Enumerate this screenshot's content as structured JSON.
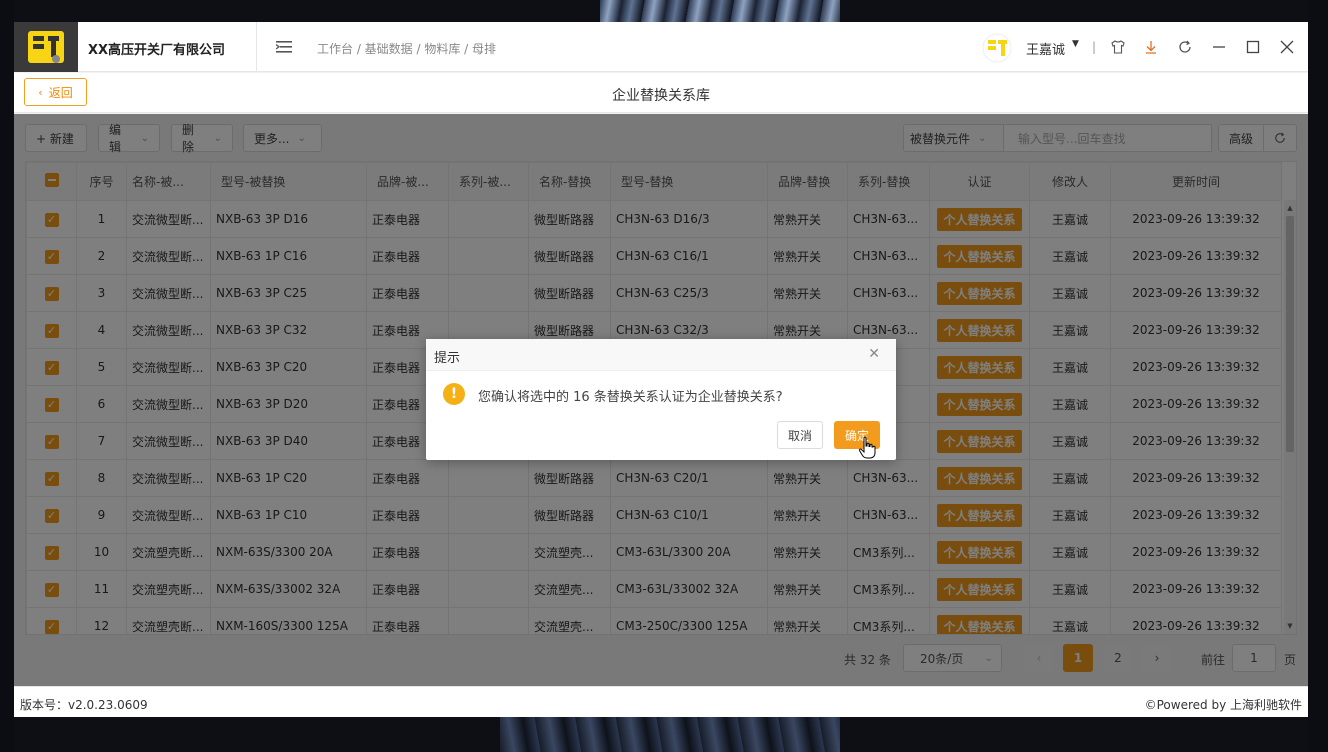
{
  "app": {
    "company": "XX高压开关厂有限公司",
    "breadcrumb": "工作台 / 基础数据 / 物料库 / 母排",
    "user_name": "王嘉诚",
    "separator": "|"
  },
  "subheader": {
    "back_label": "返回",
    "title": "企业替换关系库"
  },
  "toolbar": {
    "new_label": "+ 新建",
    "edit_label": "编辑",
    "delete_label": "删除",
    "more_label": "更多...",
    "search_scope": "被替换元件",
    "search_placeholder": "输入型号...回车查找",
    "advanced_label": "高级"
  },
  "table": {
    "columns": [
      "序号",
      "名称-被...",
      "型号-被替换",
      "品牌-被...",
      "系列-被...",
      "名称-替换",
      "型号-替换",
      "品牌-替换",
      "系列-替换",
      "认证",
      "修改人",
      "更新时间"
    ],
    "rows": [
      {
        "no": "1",
        "name_old": "交流微型断...",
        "model_old": "NXB-63 3P D16",
        "brand_old": "正泰电器",
        "series_old": "",
        "name_new": "微型断路器",
        "model_new": "CH3N-63 D16/3",
        "brand_new": "常熟开关",
        "series_new": "CH3N-63...",
        "cert": "个人替换关系",
        "editor": "王嘉诚",
        "updated": "2023-09-26 13:39:32"
      },
      {
        "no": "2",
        "name_old": "交流微型断...",
        "model_old": "NXB-63 1P C16",
        "brand_old": "正泰电器",
        "series_old": "",
        "name_new": "微型断路器",
        "model_new": "CH3N-63 C16/1",
        "brand_new": "常熟开关",
        "series_new": "CH3N-63...",
        "cert": "个人替换关系",
        "editor": "王嘉诚",
        "updated": "2023-09-26 13:39:32"
      },
      {
        "no": "3",
        "name_old": "交流微型断...",
        "model_old": "NXB-63 3P C25",
        "brand_old": "正泰电器",
        "series_old": "",
        "name_new": "微型断路器",
        "model_new": "CH3N-63 C25/3",
        "brand_new": "常熟开关",
        "series_new": "CH3N-63...",
        "cert": "个人替换关系",
        "editor": "王嘉诚",
        "updated": "2023-09-26 13:39:32"
      },
      {
        "no": "4",
        "name_old": "交流微型断...",
        "model_old": "NXB-63 3P C32",
        "brand_old": "正泰电器",
        "series_old": "",
        "name_new": "微型断路器",
        "model_new": "CH3N-63 C32/3",
        "brand_new": "常熟开关",
        "series_new": "CH3N-63...",
        "cert": "个人替换关系",
        "editor": "王嘉诚",
        "updated": "2023-09-26 13:39:32"
      },
      {
        "no": "5",
        "name_old": "交流微型断...",
        "model_old": "NXB-63 3P C20",
        "brand_old": "正泰电器",
        "series_old": "",
        "name_new": "",
        "model_new": "",
        "brand_new": "",
        "series_new": "",
        "cert": "个人替换关系",
        "editor": "王嘉诚",
        "updated": "2023-09-26 13:39:32"
      },
      {
        "no": "6",
        "name_old": "交流微型断...",
        "model_old": "NXB-63 3P D20",
        "brand_old": "正泰电器",
        "series_old": "",
        "name_new": "",
        "model_new": "",
        "brand_new": "",
        "series_new": "",
        "cert": "个人替换关系",
        "editor": "王嘉诚",
        "updated": "2023-09-26 13:39:32"
      },
      {
        "no": "7",
        "name_old": "交流微型断...",
        "model_old": "NXB-63 3P D40",
        "brand_old": "正泰电器",
        "series_old": "",
        "name_new": "",
        "model_new": "",
        "brand_new": "",
        "series_new": "",
        "cert": "个人替换关系",
        "editor": "王嘉诚",
        "updated": "2023-09-26 13:39:32"
      },
      {
        "no": "8",
        "name_old": "交流微型断...",
        "model_old": "NXB-63 1P C20",
        "brand_old": "正泰电器",
        "series_old": "",
        "name_new": "微型断路器",
        "model_new": "CH3N-63 C20/1",
        "brand_new": "常熟开关",
        "series_new": "CH3N-63...",
        "cert": "个人替换关系",
        "editor": "王嘉诚",
        "updated": "2023-09-26 13:39:32"
      },
      {
        "no": "9",
        "name_old": "交流微型断...",
        "model_old": "NXB-63 1P C10",
        "brand_old": "正泰电器",
        "series_old": "",
        "name_new": "微型断路器",
        "model_new": "CH3N-63 C10/1",
        "brand_new": "常熟开关",
        "series_new": "CH3N-63...",
        "cert": "个人替换关系",
        "editor": "王嘉诚",
        "updated": "2023-09-26 13:39:32"
      },
      {
        "no": "10",
        "name_old": "交流塑壳断...",
        "model_old": "NXM-63S/3300 20A",
        "brand_old": "正泰电器",
        "series_old": "",
        "name_new": "交流塑壳...",
        "model_new": "CM3-63L/3300 20A",
        "brand_new": "常熟开关",
        "series_new": "CM3系列...",
        "cert": "个人替换关系",
        "editor": "王嘉诚",
        "updated": "2023-09-26 13:39:32"
      },
      {
        "no": "11",
        "name_old": "交流塑壳断...",
        "model_old": "NXM-63S/33002 32A",
        "brand_old": "正泰电器",
        "series_old": "",
        "name_new": "交流塑壳...",
        "model_new": "CM3-63L/33002 32A",
        "brand_new": "常熟开关",
        "series_new": "CM3系列...",
        "cert": "个人替换关系",
        "editor": "王嘉诚",
        "updated": "2023-09-26 13:39:32"
      },
      {
        "no": "12",
        "name_old": "交流塑壳断...",
        "model_old": "NXM-160S/3300 125A",
        "brand_old": "正泰电器",
        "series_old": "",
        "name_new": "交流塑壳...",
        "model_new": "CM3-250C/3300 125A",
        "brand_new": "常熟开关",
        "series_new": "CM3系列...",
        "cert": "个人替换关系",
        "editor": "王嘉诚",
        "updated": "2023-09-26 13:39:32"
      }
    ]
  },
  "pager": {
    "total": "共 32 条",
    "page_size": "20条/页",
    "pages": [
      "1",
      "2"
    ],
    "goto_label": "前往",
    "goto_value": "1",
    "unit": "页"
  },
  "footer": {
    "version": "版本号：v2.0.23.0609",
    "powered": "©Powered by 上海利驰软件"
  },
  "dialog": {
    "title": "提示",
    "message": "您确认将选中的 16 条替换关系认证为企业替换关系?",
    "cancel_label": "取消",
    "confirm_label": "确定"
  },
  "colors": {
    "accent": "#f29b1d",
    "warning": "#f5b016"
  }
}
